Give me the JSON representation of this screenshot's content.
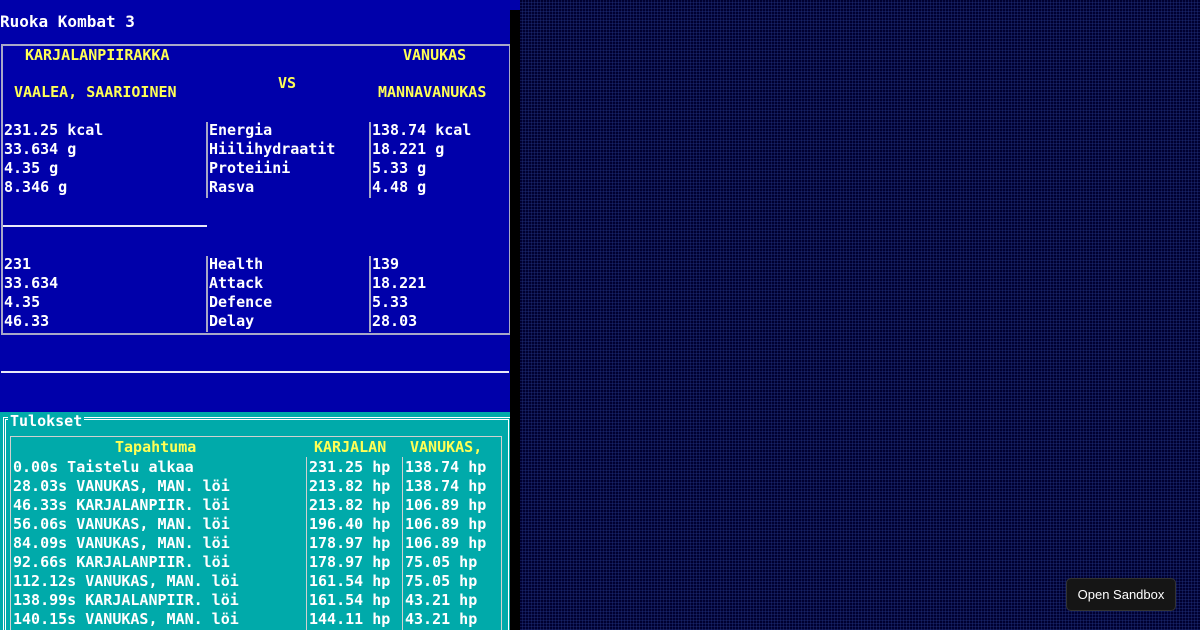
{
  "app": {
    "title": "Ruoka Kombat 3"
  },
  "fighters": {
    "left": {
      "name1": "KARJALANPIIRAKKA",
      "name2": "VAALEA, SAARIOINEN"
    },
    "vs": "VS",
    "right": {
      "name1": "VANUKAS",
      "name2": "MANNAVANUKAS"
    }
  },
  "nutrients": {
    "left": [
      "231.25 kcal",
      "33.634 g",
      "4.35 g",
      "8.346 g"
    ],
    "labels": [
      "Energia",
      "Hiilihydraatit",
      "Proteiini",
      "Rasva"
    ],
    "right": [
      "138.74 kcal",
      "18.221 g",
      "5.33 g",
      "4.48 g"
    ]
  },
  "stats": {
    "left": [
      "231",
      "33.634",
      "4.35",
      "46.33"
    ],
    "labels": [
      "Health",
      "Attack",
      "Defence",
      "Delay"
    ],
    "right": [
      "139",
      "18.221",
      "5.33",
      "28.03"
    ]
  },
  "results": {
    "caption": "Tulokset",
    "headers": {
      "event": "Tapahtuma",
      "left": "KARJALAN",
      "right": "VANUKAS,"
    },
    "rows": [
      {
        "event": "0.00s Taistelu alkaa",
        "left": "231.25 hp",
        "right": "138.74 hp"
      },
      {
        "event": "28.03s VANUKAS, MAN. löi",
        "left": "213.82 hp",
        "right": "138.74 hp"
      },
      {
        "event": "46.33s KARJALANPIIR. löi",
        "left": "213.82 hp",
        "right": "106.89 hp"
      },
      {
        "event": "56.06s VANUKAS, MAN. löi",
        "left": "196.40 hp",
        "right": "106.89 hp"
      },
      {
        "event": "84.09s VANUKAS, MAN. löi",
        "left": "178.97 hp",
        "right": "106.89 hp"
      },
      {
        "event": "92.66s KARJALANPIIR. löi",
        "left": "178.97 hp",
        "right": "75.05 hp"
      },
      {
        "event": "112.12s VANUKAS, MAN. löi",
        "left": "161.54 hp",
        "right": "75.05 hp"
      },
      {
        "event": "138.99s KARJALANPIIR. löi",
        "left": "161.54 hp",
        "right": "43.21 hp"
      },
      {
        "event": "140.15s VANUKAS, MAN. löi",
        "left": "144.11 hp",
        "right": "43.21 hp"
      }
    ]
  },
  "sandbox_button": "Open Sandbox"
}
